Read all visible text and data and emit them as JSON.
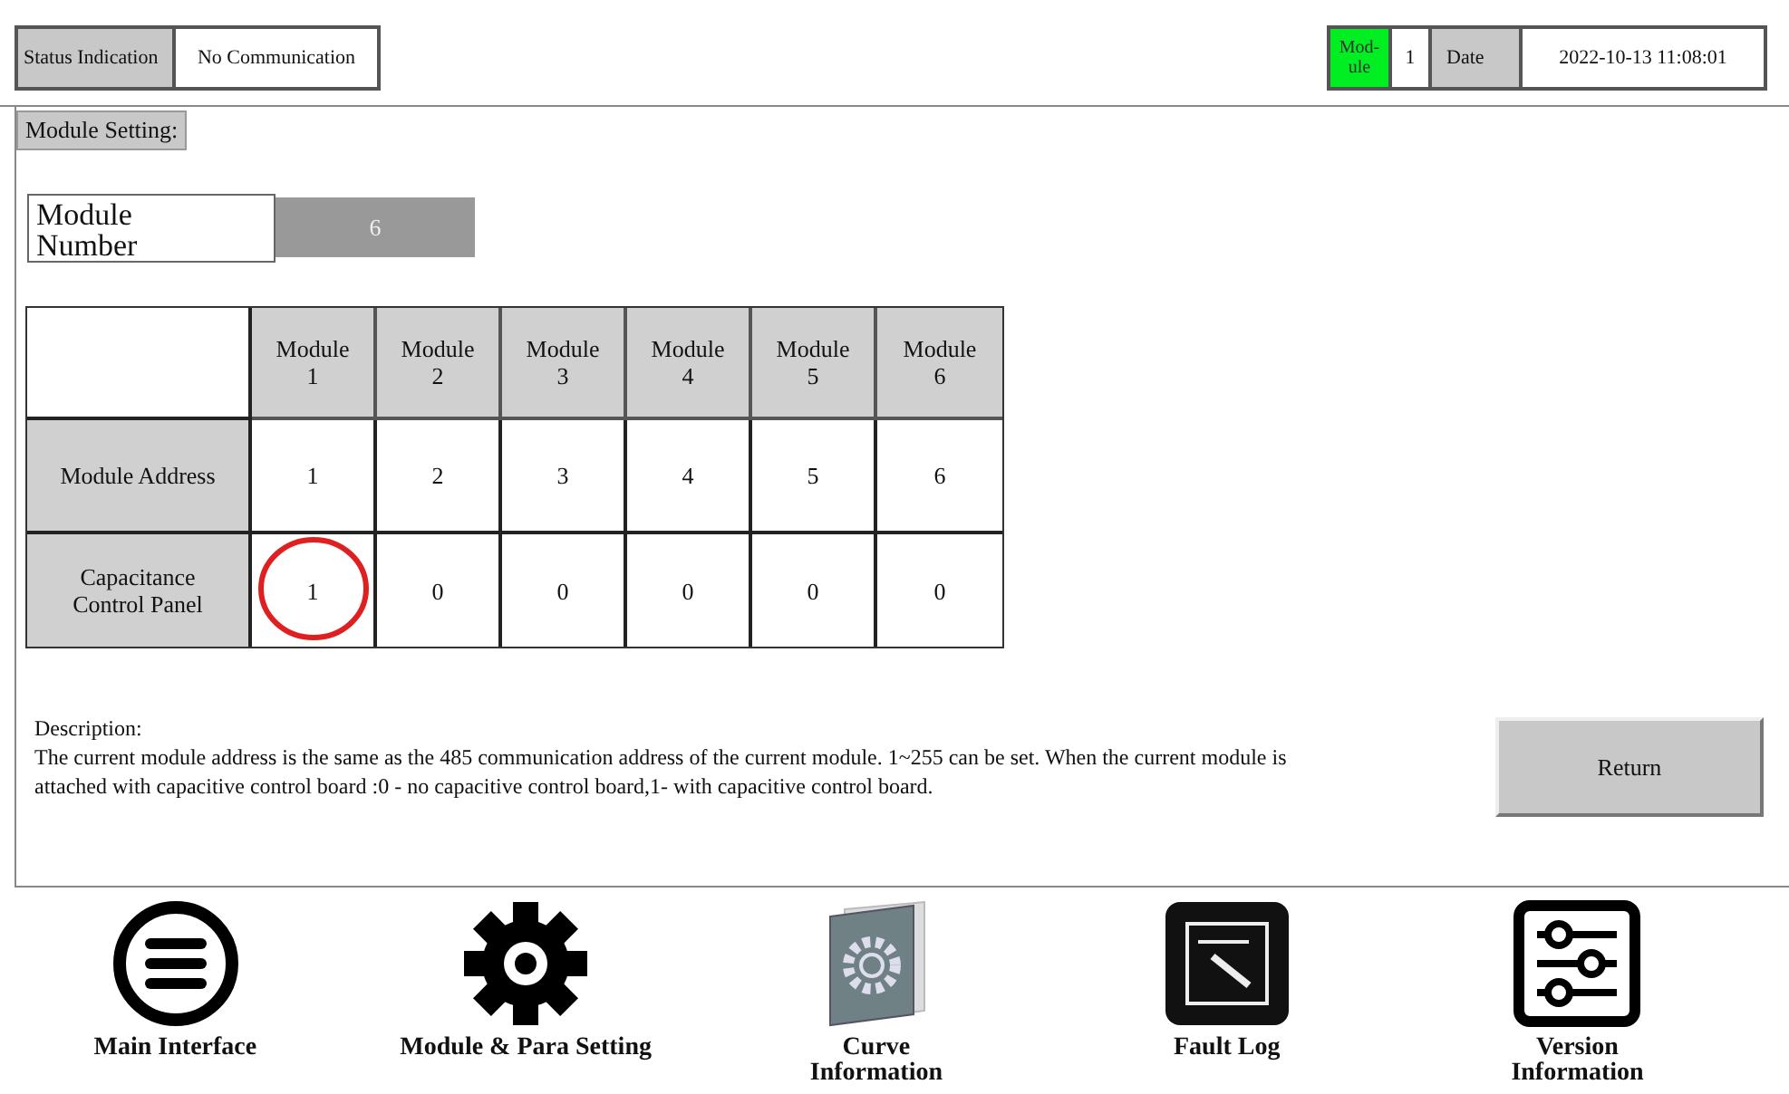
{
  "header": {
    "status_label": "Status Indication",
    "status_value": "No Communication",
    "module_label": "Mod-ule",
    "module_value": "1",
    "date_label": "Date",
    "date_value": "2022-10-13 11:08:01"
  },
  "panel": {
    "title": "Module Setting:",
    "module_number_label": "Module Number",
    "module_number_value": "6"
  },
  "table": {
    "columns": [
      "Module 1",
      "Module 2",
      "Module 3",
      "Module 4",
      "Module 5",
      "Module 6"
    ],
    "rows": [
      {
        "label": "Module Address",
        "cells": [
          {
            "text": "1",
            "circled": false
          },
          {
            "text": "2",
            "circled": false
          },
          {
            "text": "3",
            "circled": false
          },
          {
            "text": "4",
            "circled": false
          },
          {
            "text": "5",
            "circled": false
          },
          {
            "text": "6",
            "circled": false
          }
        ]
      },
      {
        "label": "Capacitance Control Panel",
        "cells": [
          {
            "text": "1",
            "circled": true
          },
          {
            "text": "0",
            "circled": false
          },
          {
            "text": "0",
            "circled": false
          },
          {
            "text": "0",
            "circled": false
          },
          {
            "text": "0",
            "circled": false
          },
          {
            "text": "0",
            "circled": false
          }
        ]
      }
    ]
  },
  "description": {
    "title": "Description:",
    "text": "The current module address is the same as the 485 communication address of the current module. 1~255 can be set. When the current module is attached with capacitive control board :0 - no capacitive control board,1- with capacitive control board."
  },
  "return_button": "Return",
  "nav": [
    {
      "kind": "menu",
      "label": "Main Interface"
    },
    {
      "kind": "gear",
      "label": "Module & Para Setting"
    },
    {
      "kind": "book",
      "label": "Curve Information"
    },
    {
      "kind": "log",
      "label": "Fault Log"
    },
    {
      "kind": "sliders",
      "label": "Version Information"
    }
  ]
}
